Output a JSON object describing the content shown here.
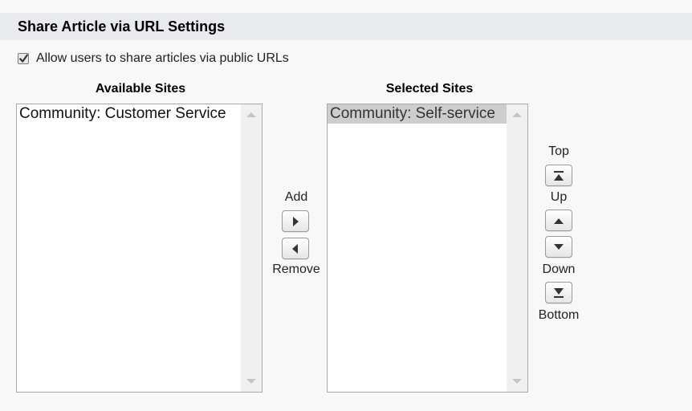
{
  "section": {
    "title": "Share Article via URL Settings"
  },
  "checkbox": {
    "label": "Allow users to share articles via public URLs",
    "checked": true
  },
  "available": {
    "header": "Available Sites",
    "options": [
      "Community: Customer Service"
    ]
  },
  "selected": {
    "header": "Selected Sites",
    "options": [
      "Community: Self-service"
    ]
  },
  "transfer": {
    "add_label": "Add",
    "remove_label": "Remove"
  },
  "order": {
    "top_label": "Top",
    "up_label": "Up",
    "down_label": "Down",
    "bottom_label": "Bottom"
  },
  "colors": {
    "header_band": "#e8eaee",
    "selected_option": "#cdcdcd",
    "icon": "#333333"
  },
  "icons": {
    "add": "caret-right-icon",
    "remove": "caret-left-icon",
    "top": "arrow-to-top-icon",
    "up": "caret-up-icon",
    "down": "caret-down-icon",
    "bottom": "arrow-to-bottom-icon",
    "check": "checkmark-icon"
  }
}
